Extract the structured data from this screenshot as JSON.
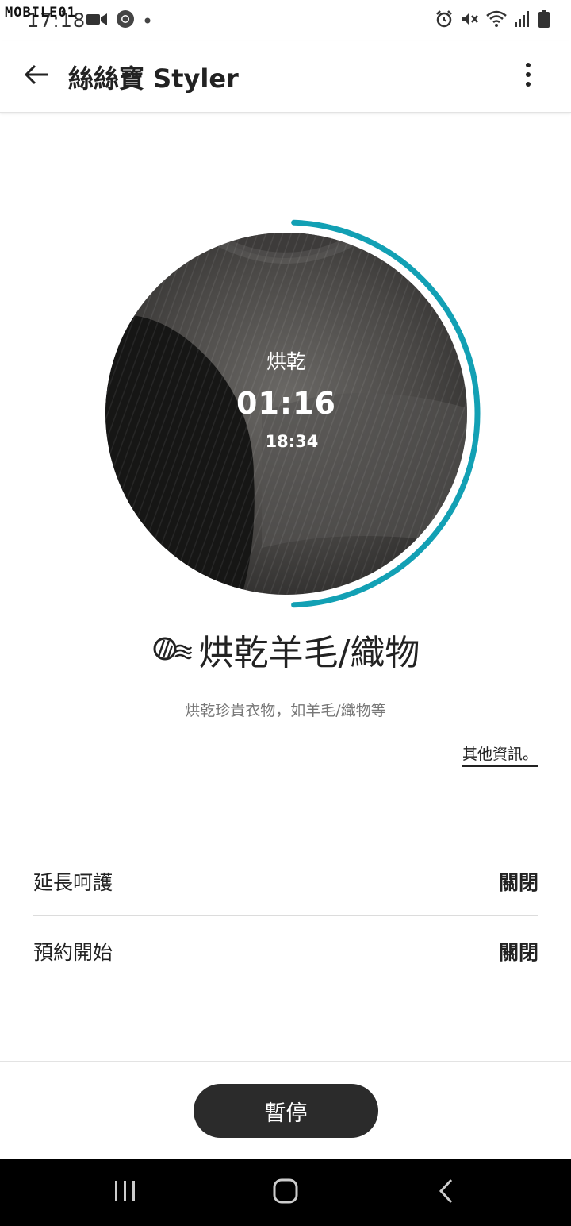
{
  "status_bar": {
    "time": "17:18",
    "watermark": "MOBILE01",
    "left_icons": [
      "image-notification-icon",
      "video-notification-icon",
      "chrome-icon",
      "more-notifications-dot-icon"
    ],
    "right_icons": [
      "alarm-icon",
      "mute-icon",
      "wifi-icon",
      "signal-icon",
      "battery-icon"
    ]
  },
  "app_bar": {
    "title": "絲絲寶 Styler",
    "back_icon": "arrow-left-icon",
    "menu_icon": "more-vertical-icon"
  },
  "dial": {
    "mode_icon": "drying-waves-icon",
    "mode_label": "烘乾",
    "remaining_time": "01:16",
    "finish_time": "18:34",
    "info_icon": "info-icon",
    "progress": 0.5,
    "accent_color": "#12a0b4"
  },
  "course": {
    "icon": "wool-yarn-icon",
    "name": "烘乾羊毛/織物",
    "description": "烘乾珍貴衣物，如羊毛/織物等",
    "more_info_link": "其他資訊。"
  },
  "settings": [
    {
      "label": "延長呵護",
      "value": "關閉"
    },
    {
      "label": "預約開始",
      "value": "關閉"
    }
  ],
  "actions": {
    "pause_label": "暫停"
  },
  "nav_bar": {
    "icons": [
      "recent-apps-icon",
      "home-icon",
      "back-icon"
    ]
  }
}
